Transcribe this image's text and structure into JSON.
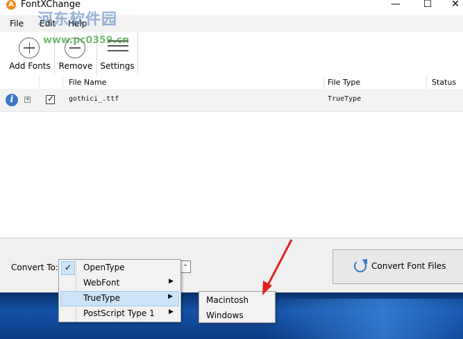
{
  "window": {
    "title": "FontXChange",
    "icon_letter": "A",
    "minimize": "—",
    "maximize": "☐",
    "close": "✕"
  },
  "menubar": {
    "items": [
      "File",
      "Edit",
      "Help"
    ]
  },
  "watermark": {
    "text": "河东软件园",
    "url": "www.pc0359.cn"
  },
  "toolbar": {
    "add_fonts": "Add Fonts",
    "remove": "Remove",
    "settings": "Settings"
  },
  "grid": {
    "columns": [
      "File Name",
      "File Type",
      "Status"
    ],
    "rows": [
      {
        "info_icon": "i",
        "expand": "+",
        "checked": true,
        "file_name": "gothici_.ttf",
        "file_type": "TrueType",
        "status": ""
      }
    ]
  },
  "convert": {
    "label": "Convert To:",
    "button": "Convert Font Files"
  },
  "dropdown_menu": {
    "items": [
      {
        "label": "OpenType",
        "checked": true,
        "submenu": false
      },
      {
        "label": "WebFont",
        "checked": false,
        "submenu": true
      },
      {
        "label": "TrueType",
        "checked": false,
        "submenu": true,
        "active": true
      },
      {
        "label": "PostScript Type 1",
        "checked": false,
        "submenu": true
      }
    ],
    "check_mark": "✓",
    "submenu_arrow": "▶"
  },
  "submenu": {
    "items": [
      "Macintosh",
      "Windows"
    ]
  },
  "colors": {
    "accent": "#3a77c8",
    "highlight": "#cce4f7",
    "annotation_arrow": "#e02020"
  }
}
